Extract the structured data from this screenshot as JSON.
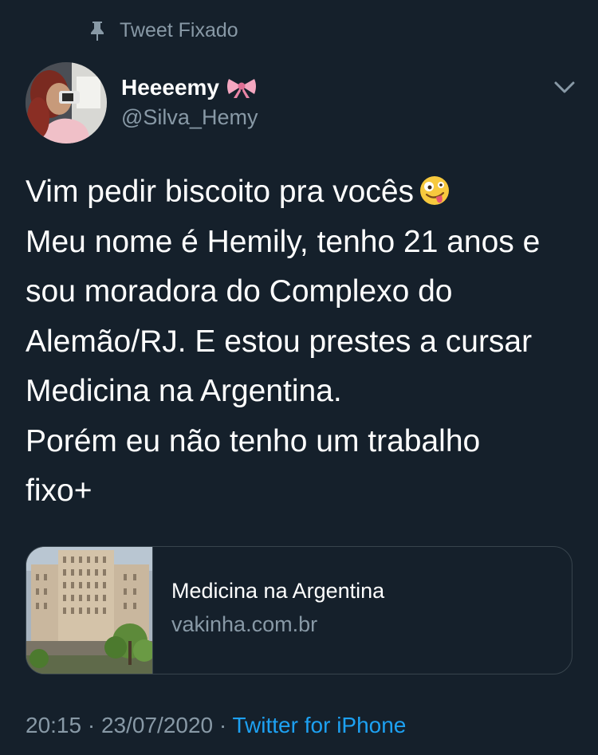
{
  "pinned": {
    "label": "Tweet Fixado"
  },
  "author": {
    "display_name": "Heeeemy",
    "handle": "@Silva_Hemy"
  },
  "tweet": {
    "lines": [
      "Vim pedir biscoito pra vocês",
      "Meu nome é Hemily, tenho 21 anos e",
      "sou moradora do Complexo do",
      "Alemão/RJ. E estou prestes a cursar",
      "Medicina na Argentina.",
      "Porém eu não tenho um trabalho",
      "fixo+"
    ]
  },
  "card": {
    "title": "Medicina na Argentina",
    "domain": "vakinha.com.br"
  },
  "meta": {
    "time": "20:15",
    "separator": "·",
    "date": "23/07/2020",
    "source": "Twitter for iPhone"
  },
  "colors": {
    "background": "#15202b",
    "secondary_text": "#8899a6",
    "link": "#1da1f2",
    "border": "#38444d"
  }
}
